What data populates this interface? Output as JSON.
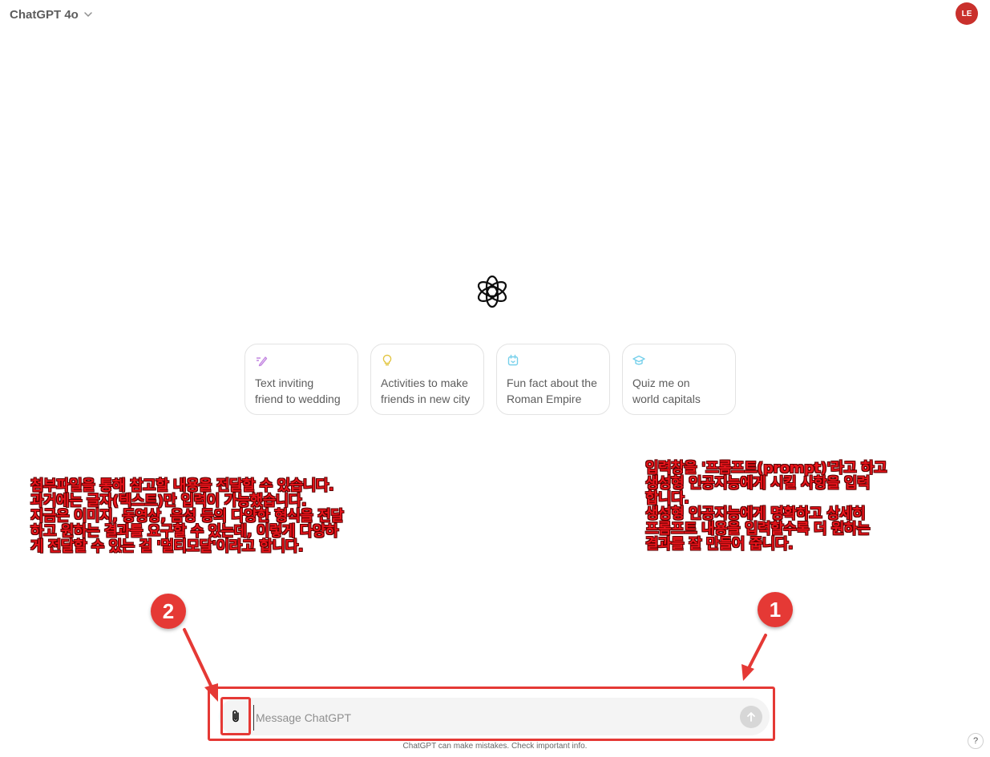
{
  "header": {
    "model_name": "ChatGPT 4o",
    "model_dropdown_icon": "chevron-down-icon",
    "avatar_initials": "LE",
    "avatar_color": "#c9302c"
  },
  "logo_icon": "openai-logo-icon",
  "suggestions": [
    {
      "label": "Text inviting\nfriend to wedding",
      "icon": "pen-icon",
      "icon_color": "#c285e0"
    },
    {
      "label": "Activities to make\nfriends in new city",
      "icon": "lightbulb-icon",
      "icon_color": "#e2c541"
    },
    {
      "label": "Fun fact about the\nRoman Empire",
      "icon": "calendar-icon",
      "icon_color": "#76d0eb"
    },
    {
      "label": "Quiz me on\nworld capitals",
      "icon": "graduation-cap-icon",
      "icon_color": "#76d0eb"
    }
  ],
  "annotations": {
    "left": "첨부파일을 통해 참고할 내용을 전달할 수 있습니다.\n과거에는 글자(텍스트)만 입력이 가능했습니다.\n지금은 이미지, 동영상, 음성 등의 다양한 형식을 전달\n하고 원하는 결과를 요구할 수 있는데, 이렇게 다양하\n게 전달할 수 있는 걸 '멀티모달'이라고 합니다.",
    "right": "입력창을 '프롬프트(prompt)'라고 하고\n생성형 인공지능에게 시킬 사항을 입력\n합니다.\n생성형 인공지능에게 명확하고 상세히\n프롬프트 내용을 입력할수록 더 원하는\n결과를 잘 만들어 줍니다.",
    "badge_1": "1",
    "badge_2": "2",
    "highlight_color": "#e53935"
  },
  "composer": {
    "attach_icon": "paperclip-icon",
    "placeholder": "Message ChatGPT",
    "value": "",
    "send_icon": "arrow-up-icon"
  },
  "footer": {
    "disclaimer": "ChatGPT can make mistakes. Check important info.",
    "help_label": "?"
  }
}
